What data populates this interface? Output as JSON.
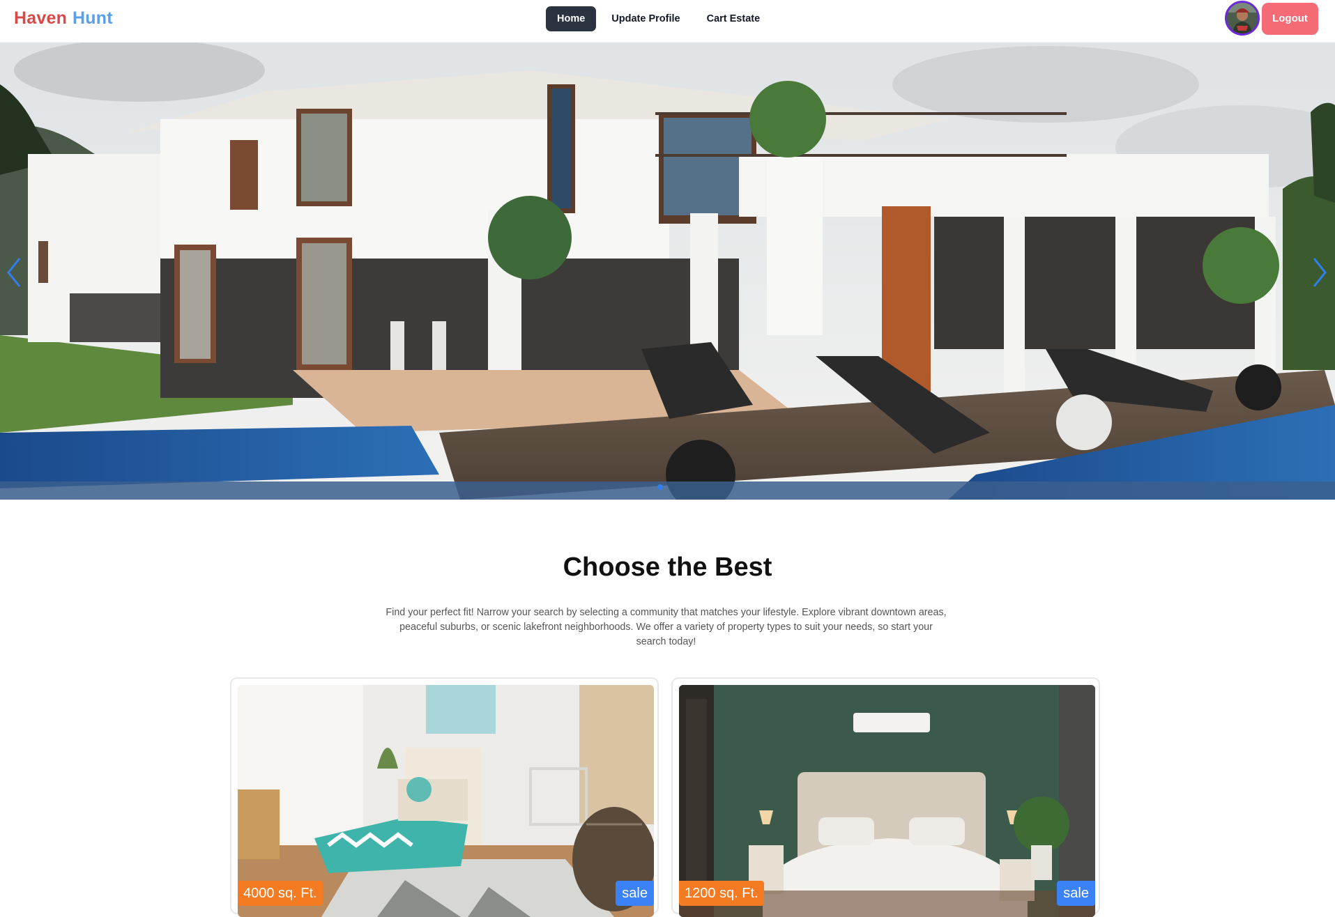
{
  "brand": {
    "first": "Haven",
    "second": "Hunt"
  },
  "nav": {
    "home": "Home",
    "update_profile": "Update Profile",
    "cart_estate": "Cart Estate"
  },
  "user": {
    "logout": "Logout"
  },
  "colors": {
    "brand_red": "#d84a4a",
    "brand_blue": "#5aa0e6",
    "nav_active": "#2b3340",
    "logout": "#f46b75",
    "area_badge": "#f47b22",
    "sale_badge": "#3b82f6",
    "carousel_accent": "#2f80ed"
  },
  "carousel": {
    "prev_icon": "chevron-left-icon",
    "next_icon": "chevron-right-icon",
    "slide_count": 3,
    "active_index": 0
  },
  "section": {
    "title": "Choose the Best",
    "description": "Find your perfect fit! Narrow your search by selecting a community that matches your lifestyle. Explore vibrant downtown areas, peaceful suburbs, or scenic lakefront neighborhoods. We offer a variety of property types to suit your needs, so start your search today!"
  },
  "listings": [
    {
      "area": "4000 sq. Ft.",
      "status": "sale"
    },
    {
      "area": "1200 sq. Ft.",
      "status": "sale"
    }
  ]
}
